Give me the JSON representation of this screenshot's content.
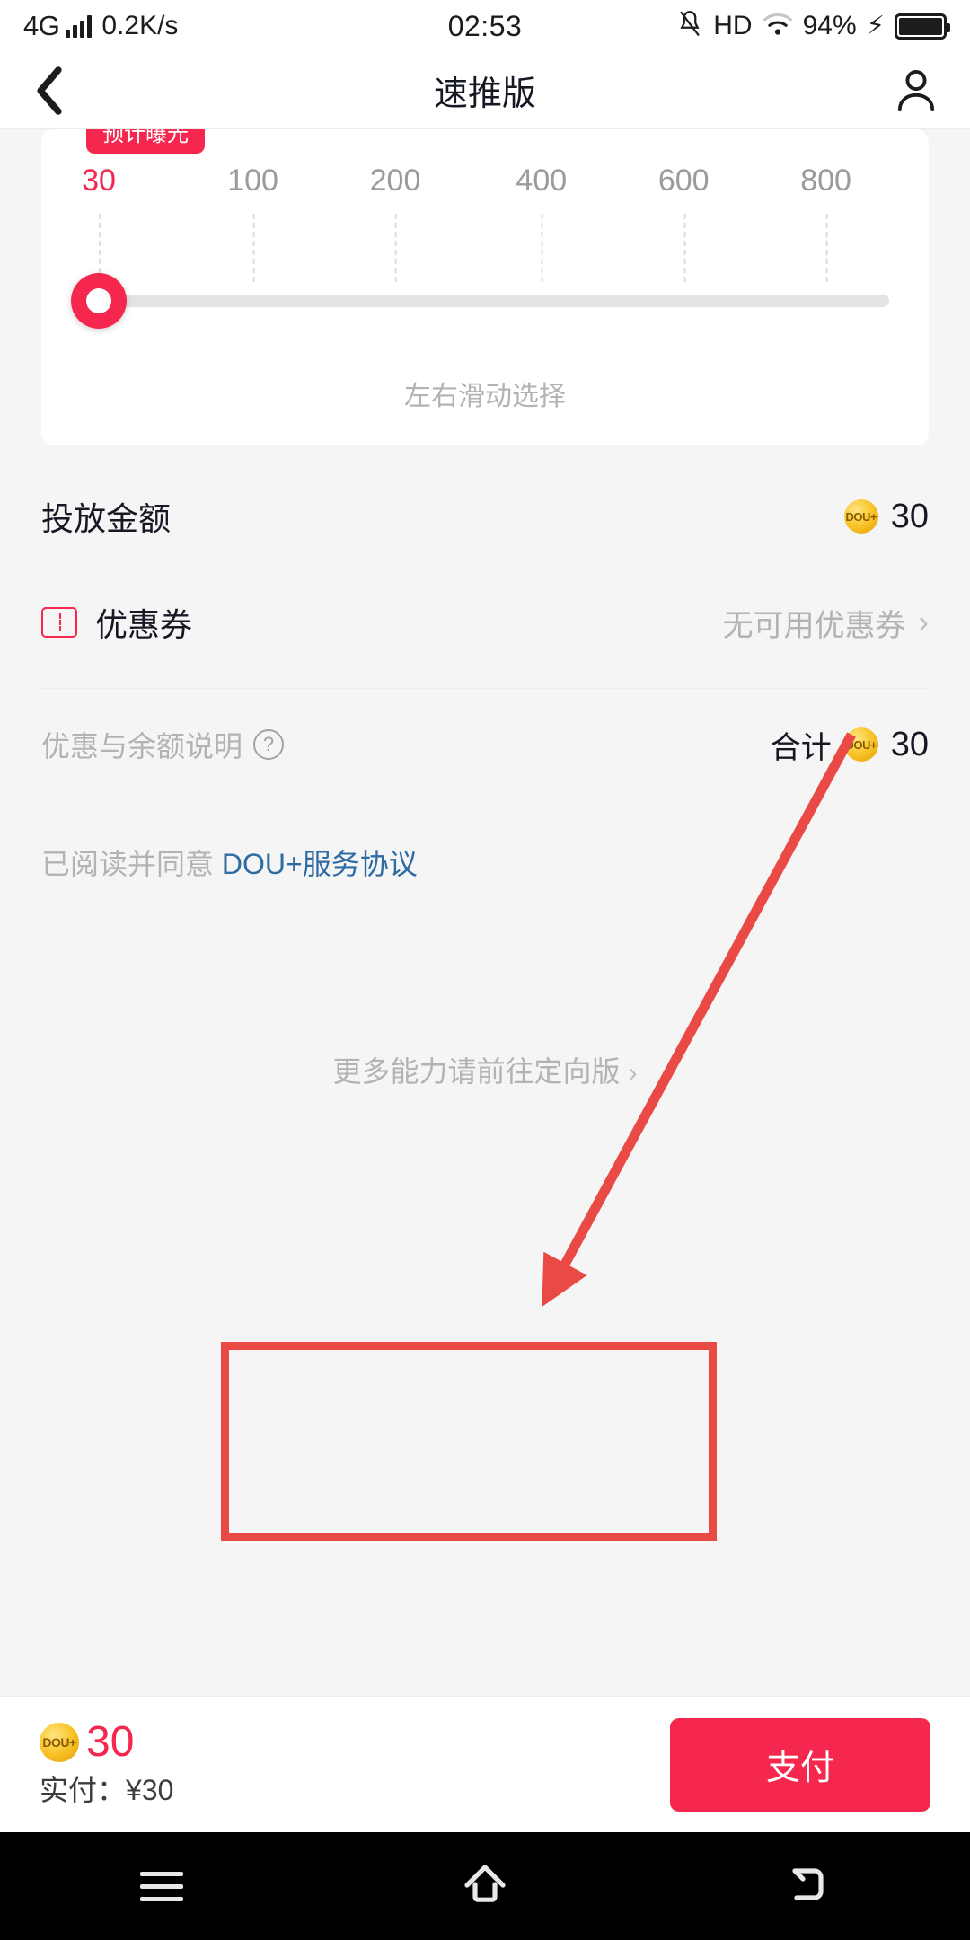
{
  "status_bar": {
    "network_type": "4G",
    "data_speed": "0.2K/s",
    "time": "02:53",
    "hd_label": "HD",
    "battery_percent": "94%",
    "icons": [
      "signal-bars-icon",
      "mute-icon",
      "hd-icon",
      "wifi-icon",
      "charging-bolt-icon",
      "battery-icon"
    ]
  },
  "nav_bar": {
    "back_icon": "chevron-left-icon",
    "title": "速推版",
    "profile_icon": "person-icon"
  },
  "slider_card": {
    "badge_label": "预计曝光",
    "hint": "左右滑动选择",
    "selected_value": "30",
    "ticks": [
      {
        "label": "30",
        "active": true,
        "pos_pct": 0
      },
      {
        "label": "100",
        "active": false,
        "pos_pct": 19.5
      },
      {
        "label": "200",
        "active": false,
        "pos_pct": 37.5
      },
      {
        "label": "400",
        "active": false,
        "pos_pct": 56
      },
      {
        "label": "600",
        "active": false,
        "pos_pct": 74
      },
      {
        "label": "800",
        "active": false,
        "pos_pct": 92
      }
    ],
    "knob_pos_pct": 0
  },
  "rows": {
    "budget": {
      "label": "投放金额",
      "coin_icon": "dou-plus-coin-icon",
      "coin_text": "DOU+",
      "value": "30"
    },
    "coupon": {
      "icon": "coupon-ticket-icon",
      "label": "优惠券",
      "value": "无可用优惠券",
      "chevron": "chevron-right-icon"
    },
    "summary": {
      "explain_label": "优惠与余额说明",
      "help_icon": "question-mark-icon",
      "total_label": "合计",
      "coin_icon": "dou-plus-coin-icon",
      "coin_text": "DOU+",
      "total_value": "30"
    },
    "agreement": {
      "prefix": "已阅读并同意 ",
      "link": "DOU+服务协议"
    },
    "more_entry": {
      "label": "更多能力请前往定向版",
      "chevron": "chevron-right-icon"
    }
  },
  "pay_bar": {
    "coin_icon": "dou-plus-coin-icon",
    "coin_text": "DOU+",
    "amount": "30",
    "actual_pay": "实付：¥30",
    "pay_button": "支付"
  },
  "android_nav": {
    "menu_icon": "hamburger-menu-icon",
    "home_icon": "home-icon",
    "back_icon": "back-arrow-icon"
  },
  "annotations": {
    "arrow_color": "#ea4a45",
    "box_color": "#ea4a45"
  },
  "colors": {
    "accent": "#f5274e",
    "link": "#2f6ba3",
    "muted": "#b2b2b7",
    "page_bg": "#f5f5f5"
  }
}
